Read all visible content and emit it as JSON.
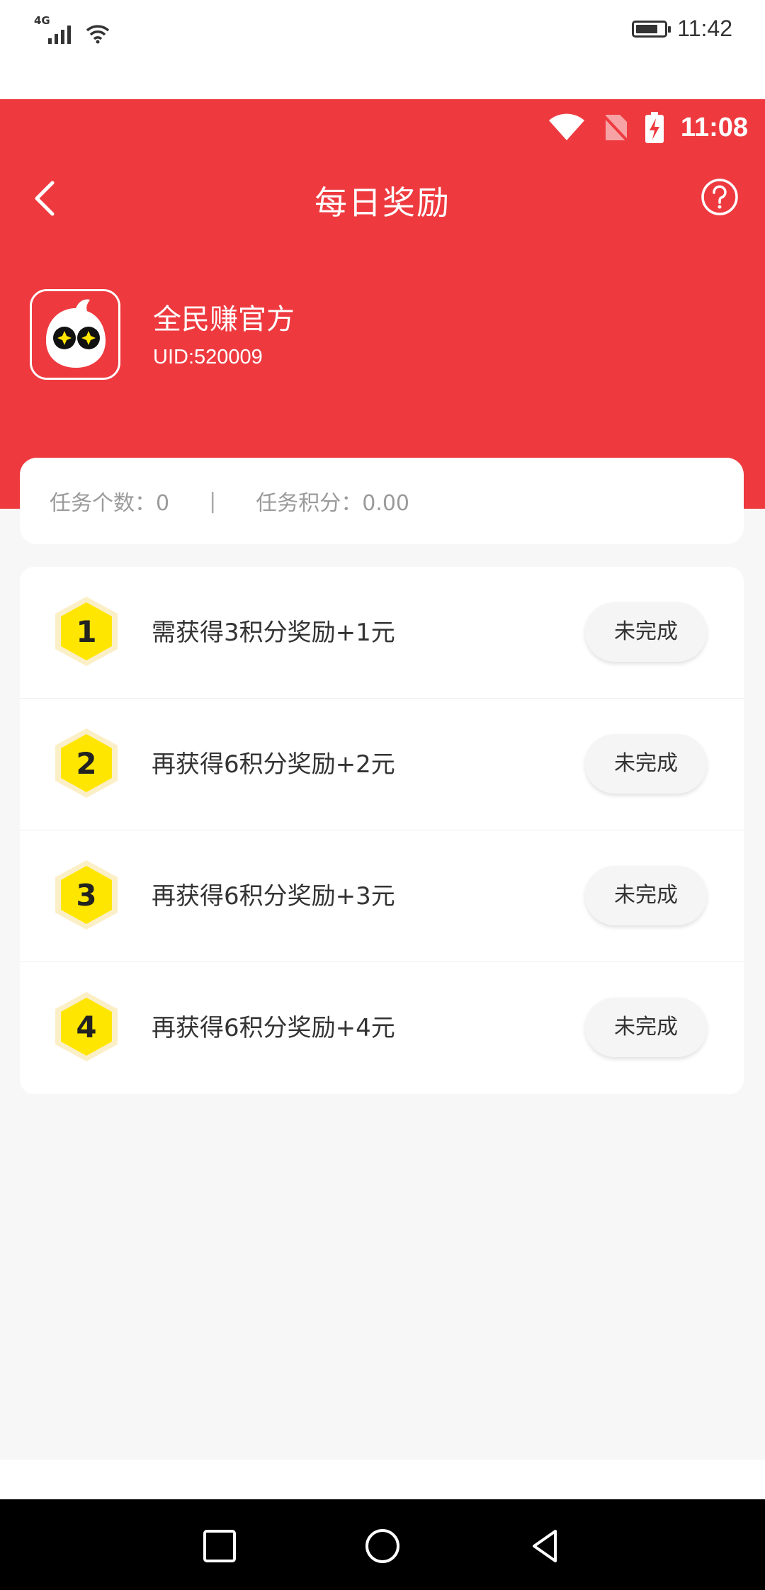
{
  "system_status": {
    "network": "4G",
    "time": "11:42"
  },
  "app_status": {
    "time": "11:08"
  },
  "header": {
    "title": "每日奖励"
  },
  "profile": {
    "name": "全民赚官方",
    "uid": "UID:520009"
  },
  "summary": {
    "task_count": "任务个数：0",
    "separator": "|",
    "task_points": "任务积分：0.00"
  },
  "tasks": [
    {
      "number": "1",
      "label": "需获得3积分奖励+1元",
      "status": "未完成"
    },
    {
      "number": "2",
      "label": "再获得6积分奖励+2元",
      "status": "未完成"
    },
    {
      "number": "3",
      "label": "再获得6积分奖励+3元",
      "status": "未完成"
    },
    {
      "number": "4",
      "label": "再获得6积分奖励+4元",
      "status": "未完成"
    }
  ],
  "colors": {
    "primary": "#ee3a3f",
    "badge": "#ffe600",
    "badge_glow": "#fbefc8"
  }
}
